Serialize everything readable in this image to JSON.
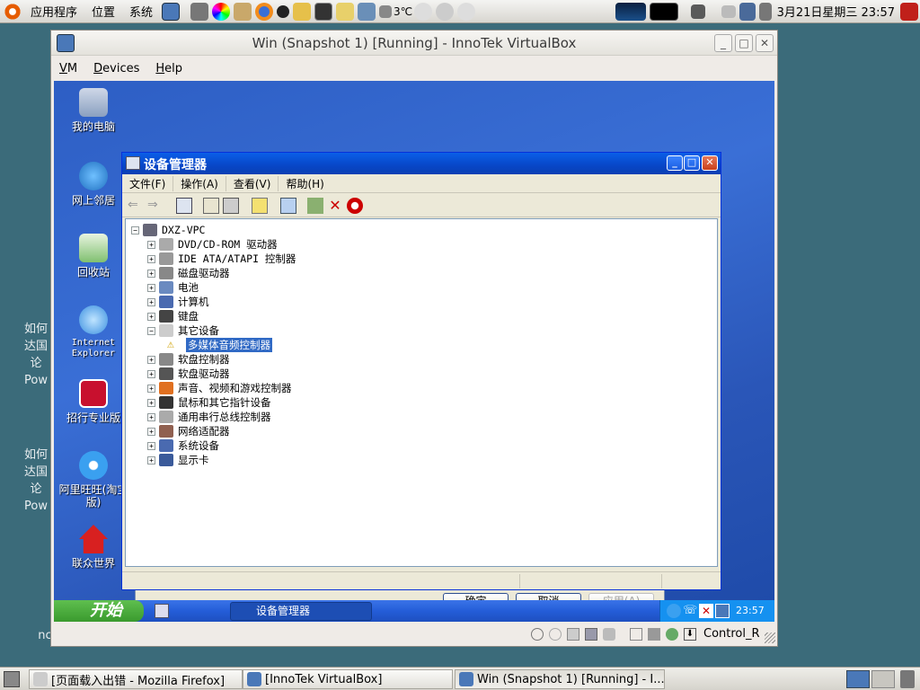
{
  "top_panel": {
    "menus": [
      "应用程序",
      "位置",
      "系统"
    ],
    "weather": "3℃",
    "datetime": "3月21日星期三 23:57"
  },
  "host_desktop": {
    "text_block_1": [
      "如何",
      "达国",
      "论",
      "Pow"
    ],
    "text_block_2": [
      "如何",
      "达国",
      "论",
      "Pow"
    ],
    "partial_label": "nc"
  },
  "vbox": {
    "title": "Win (Snapshot 1) [Running] - InnoTek VirtualBox",
    "menu": [
      "VM",
      "Devices",
      "Help"
    ],
    "status_right": "Control_R"
  },
  "guest_icons": [
    "我的电脑",
    "网上邻居",
    "回收站",
    "Internet Explorer",
    "招行专业版",
    "阿里旺旺(淘宝版)",
    "联众世界"
  ],
  "device_manager": {
    "title": "设备管理器",
    "menu": [
      "文件(F)",
      "操作(A)",
      "查看(V)",
      "帮助(H)"
    ],
    "root": "DXZ-VPC",
    "categories": [
      {
        "label": "DVD/CD-ROM 驱动器",
        "expanded": false
      },
      {
        "label": "IDE ATA/ATAPI 控制器",
        "expanded": false
      },
      {
        "label": "磁盘驱动器",
        "expanded": false
      },
      {
        "label": "电池",
        "expanded": false
      },
      {
        "label": "计算机",
        "expanded": false
      },
      {
        "label": "键盘",
        "expanded": false
      },
      {
        "label": "其它设备",
        "expanded": true
      },
      {
        "label": "多媒体音频控制器",
        "child": true,
        "selected": true
      },
      {
        "label": "软盘控制器",
        "expanded": false
      },
      {
        "label": "软盘驱动器",
        "expanded": false
      },
      {
        "label": "声音、视频和游戏控制器",
        "expanded": false
      },
      {
        "label": "鼠标和其它指针设备",
        "expanded": false
      },
      {
        "label": "通用串行总线控制器",
        "expanded": false
      },
      {
        "label": "网络适配器",
        "expanded": false
      },
      {
        "label": "系统设备",
        "expanded": false
      },
      {
        "label": "显示卡",
        "expanded": false
      }
    ]
  },
  "back_dialog": {
    "ok": "确定",
    "cancel": "取消",
    "apply": "应用(A)"
  },
  "guest_taskbar": {
    "start": "开始",
    "task": "设备管理器",
    "clock": "23:57"
  },
  "bottom_panel": {
    "tasks": [
      "[页面载入出错 - Mozilla Firefox]",
      "[InnoTek VirtualBox]",
      "Win (Snapshot 1) [Running] - I..."
    ]
  }
}
